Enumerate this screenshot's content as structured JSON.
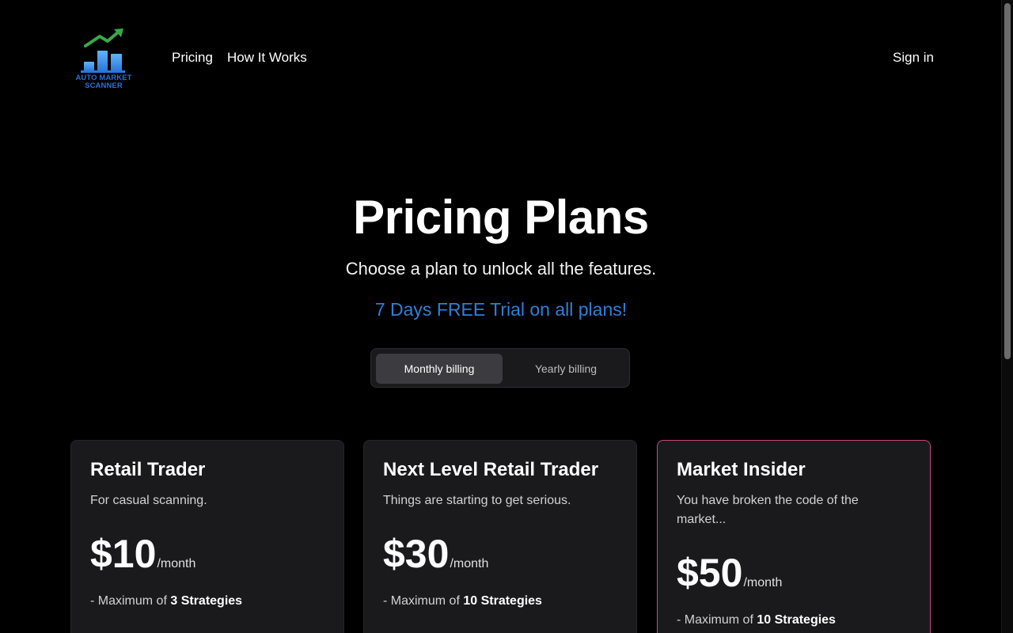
{
  "header": {
    "logo_text_line1": "AUTO MARKET",
    "logo_text_line2": "SCANNER",
    "nav": [
      {
        "label": "Pricing"
      },
      {
        "label": "How It Works"
      }
    ],
    "signin_label": "Sign in"
  },
  "hero": {
    "title": "Pricing Plans",
    "subtitle": "Choose a plan to unlock all the features.",
    "trial": "7 Days FREE Trial on all plans!"
  },
  "billing": {
    "monthly_label": "Monthly billing",
    "yearly_label": "Yearly billing",
    "selected": "Monthly billing"
  },
  "plans": [
    {
      "name": "Retail Trader",
      "description": "For casual scanning.",
      "price": "$10",
      "period": "/month",
      "feature_prefix": "- Maximum of ",
      "feature_bold": "3 Strategies"
    },
    {
      "name": "Next Level Retail Trader",
      "description": "Things are starting to get serious.",
      "price": "$30",
      "period": "/month",
      "feature_prefix": "- Maximum of ",
      "feature_bold": "10 Strategies"
    },
    {
      "name": "Market Insider",
      "description": "You have broken the code of the market...",
      "price": "$50",
      "period": "/month",
      "feature_prefix": "- Maximum of ",
      "feature_bold": "10 Strategies"
    }
  ],
  "colors": {
    "background": "#000000",
    "card": "#1a1a1c",
    "accent_blue": "#2f7fd8",
    "highlight_border": "#c9487c",
    "logo_green": "#3aa84a"
  },
  "icons": {
    "logo": "bar-chart-trend-up-icon"
  }
}
